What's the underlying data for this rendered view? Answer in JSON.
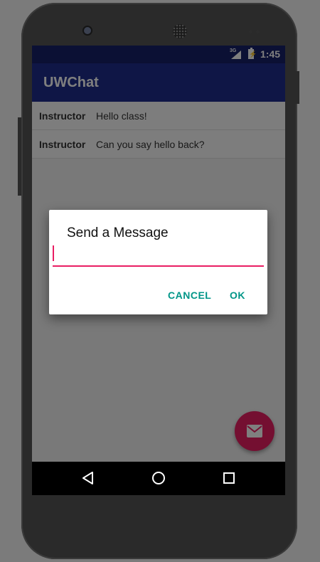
{
  "status_bar": {
    "network": "3G",
    "time": "1:45"
  },
  "app": {
    "title": "UWChat"
  },
  "messages": [
    {
      "author": "Instructor",
      "text": "Hello class!"
    },
    {
      "author": "Instructor",
      "text": "Can you say hello back?"
    }
  ],
  "dialog": {
    "title": "Send a Message",
    "input_value": "",
    "cancel_label": "CANCEL",
    "ok_label": "OK"
  },
  "fab": {
    "icon": "mail-icon",
    "color": "#e91e63"
  },
  "navigation": {
    "icons": [
      "back-icon",
      "home-icon",
      "recents-icon"
    ]
  },
  "colors": {
    "primary": "#1f2c8c",
    "primary_dark": "#172068",
    "accent": "#e91e63",
    "button_text": "#009688"
  }
}
